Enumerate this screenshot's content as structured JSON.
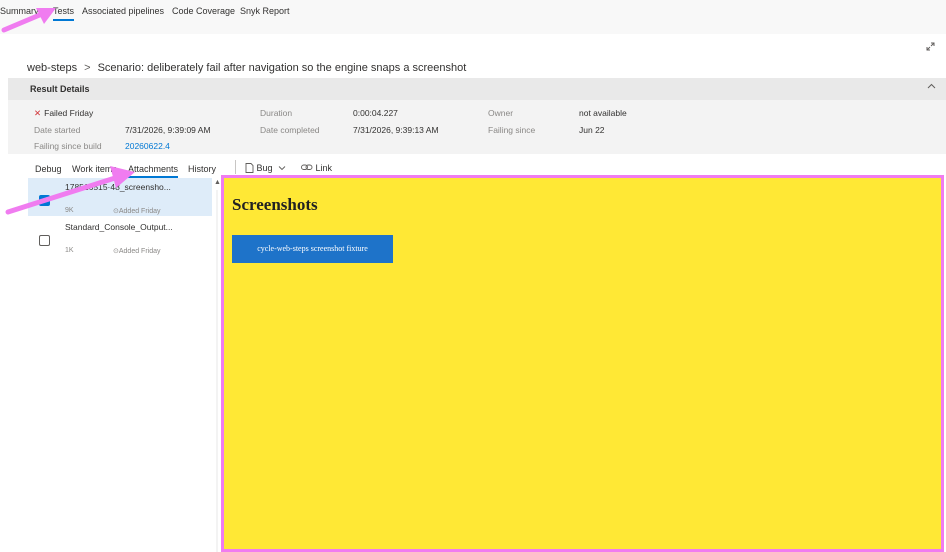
{
  "top_tabs": [
    "Summary",
    "Tests",
    "Associated pipelines",
    "Code Coverage",
    "Snyk Report"
  ],
  "active_top_tab": "Tests",
  "breadcrumb": {
    "parent": "web-steps",
    "separator": ">",
    "current": "Scenario: deliberately fail after navigation so the engine snaps a screenshot"
  },
  "result_details": {
    "title": "Result Details",
    "status": "Failed Friday",
    "date_started_label": "Date started",
    "date_started": "7/31/2026, 9:39:09 AM",
    "failing_since_build_label": "Failing since build",
    "failing_since_build": "20260622.4",
    "duration_label": "Duration",
    "duration": "0:00:04.227",
    "date_completed_label": "Date completed",
    "date_completed": "7/31/2026, 9:39:13 AM",
    "owner_label": "Owner",
    "owner": "not available",
    "failing_since_label": "Failing since",
    "failing_since": "Jun 22"
  },
  "sub_tabs": [
    "Debug",
    "Work items",
    "Attachments",
    "History"
  ],
  "active_sub_tab": "Attachments",
  "toolbar": {
    "bug_label": "Bug",
    "link_label": "Link"
  },
  "attachments": [
    {
      "name": "178516515·48_screensho...",
      "size": "9K",
      "added": "Added Friday",
      "checked": true
    },
    {
      "name": "Standard_Console_Output...",
      "size": "1K",
      "added": "Added Friday",
      "checked": false
    }
  ],
  "preview": {
    "heading": "Screenshots",
    "button_label": "cycle-web-steps screenshot fixture"
  },
  "colors": {
    "accent": "#0078d4",
    "preview_bg": "#ffe835",
    "highlight_border": "#f07cf0",
    "arrow": "#f07cf0",
    "fail": "#d13438"
  }
}
